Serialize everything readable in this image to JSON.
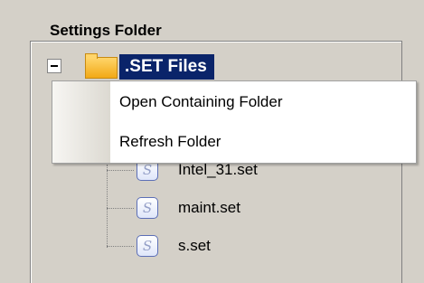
{
  "group": {
    "title": "Settings Folder"
  },
  "tree": {
    "root": {
      "label": ".SET Files",
      "icon": "folder-icon",
      "expanded": true
    },
    "files": [
      {
        "label": "Intel_31.set",
        "icon": "set-file-icon"
      },
      {
        "label": "maint.set",
        "icon": "set-file-icon"
      },
      {
        "label": "s.set",
        "icon": "set-file-icon"
      }
    ],
    "file_icon_glyph": "S"
  },
  "context_menu": {
    "items": [
      {
        "label": "Open Containing Folder"
      },
      {
        "label": "Refresh Folder"
      }
    ]
  },
  "colors": {
    "selection": "#0a246a",
    "window": "#d4d0c8"
  }
}
